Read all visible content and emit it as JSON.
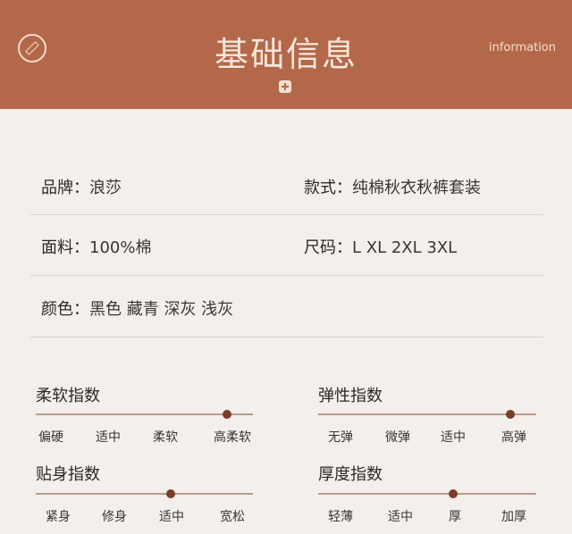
{
  "header": {
    "title": "基础信息",
    "subtitle": "information"
  },
  "info": {
    "brand": {
      "label": "品牌：",
      "value": "浪莎"
    },
    "style": {
      "label": "款式：",
      "value": "纯棉秋衣秋裤套装"
    },
    "fabric": {
      "label": "面料：",
      "value": "100%棉"
    },
    "size": {
      "label": "尺码：",
      "value": "L XL 2XL 3XL"
    },
    "color": {
      "label": "颜色：",
      "value": "黑色 藏青 深灰 浅灰"
    }
  },
  "indices": [
    {
      "title": "柔软指数",
      "labels": [
        "偏硬",
        "适中",
        "柔软",
        "高柔软"
      ],
      "level": 0.88
    },
    {
      "title": "弹性指数",
      "labels": [
        "无弹",
        "微弹",
        "适中",
        "高弹"
      ],
      "level": 0.88
    },
    {
      "title": "贴身指数",
      "labels": [
        "紧身",
        "修身",
        "适中",
        "宽松"
      ],
      "level": 0.62
    },
    {
      "title": "厚度指数",
      "labels": [
        "轻薄",
        "适中",
        "厚",
        "加厚"
      ],
      "level": 0.62
    }
  ]
}
